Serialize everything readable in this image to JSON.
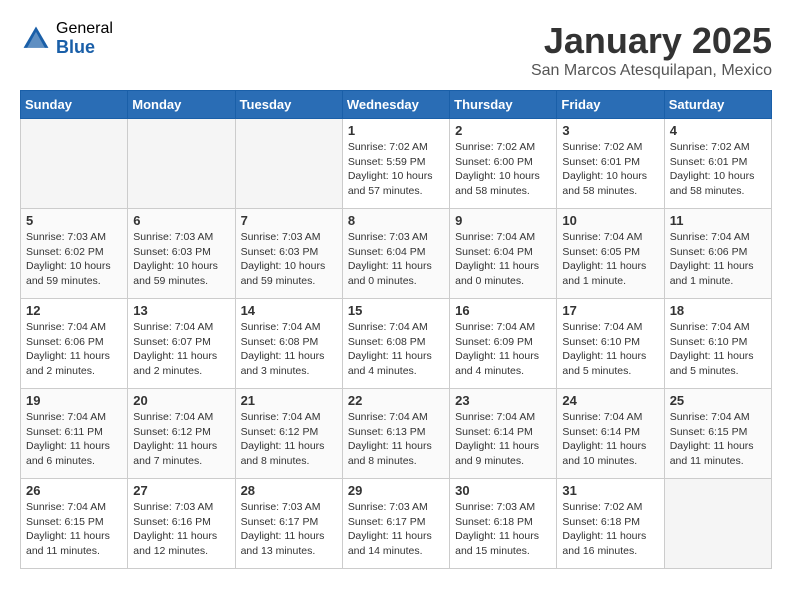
{
  "header": {
    "logo_general": "General",
    "logo_blue": "Blue",
    "month_title": "January 2025",
    "location": "San Marcos Atesquilapan, Mexico"
  },
  "days_of_week": [
    "Sunday",
    "Monday",
    "Tuesday",
    "Wednesday",
    "Thursday",
    "Friday",
    "Saturday"
  ],
  "weeks": [
    [
      {
        "num": "",
        "empty": true
      },
      {
        "num": "",
        "empty": true
      },
      {
        "num": "",
        "empty": true
      },
      {
        "num": "1",
        "sunrise": "Sunrise: 7:02 AM",
        "sunset": "Sunset: 5:59 PM",
        "daylight": "Daylight: 10 hours and 57 minutes."
      },
      {
        "num": "2",
        "sunrise": "Sunrise: 7:02 AM",
        "sunset": "Sunset: 6:00 PM",
        "daylight": "Daylight: 10 hours and 58 minutes."
      },
      {
        "num": "3",
        "sunrise": "Sunrise: 7:02 AM",
        "sunset": "Sunset: 6:01 PM",
        "daylight": "Daylight: 10 hours and 58 minutes."
      },
      {
        "num": "4",
        "sunrise": "Sunrise: 7:02 AM",
        "sunset": "Sunset: 6:01 PM",
        "daylight": "Daylight: 10 hours and 58 minutes."
      }
    ],
    [
      {
        "num": "5",
        "sunrise": "Sunrise: 7:03 AM",
        "sunset": "Sunset: 6:02 PM",
        "daylight": "Daylight: 10 hours and 59 minutes."
      },
      {
        "num": "6",
        "sunrise": "Sunrise: 7:03 AM",
        "sunset": "Sunset: 6:03 PM",
        "daylight": "Daylight: 10 hours and 59 minutes."
      },
      {
        "num": "7",
        "sunrise": "Sunrise: 7:03 AM",
        "sunset": "Sunset: 6:03 PM",
        "daylight": "Daylight: 10 hours and 59 minutes."
      },
      {
        "num": "8",
        "sunrise": "Sunrise: 7:03 AM",
        "sunset": "Sunset: 6:04 PM",
        "daylight": "Daylight: 11 hours and 0 minutes."
      },
      {
        "num": "9",
        "sunrise": "Sunrise: 7:04 AM",
        "sunset": "Sunset: 6:04 PM",
        "daylight": "Daylight: 11 hours and 0 minutes."
      },
      {
        "num": "10",
        "sunrise": "Sunrise: 7:04 AM",
        "sunset": "Sunset: 6:05 PM",
        "daylight": "Daylight: 11 hours and 1 minute."
      },
      {
        "num": "11",
        "sunrise": "Sunrise: 7:04 AM",
        "sunset": "Sunset: 6:06 PM",
        "daylight": "Daylight: 11 hours and 1 minute."
      }
    ],
    [
      {
        "num": "12",
        "sunrise": "Sunrise: 7:04 AM",
        "sunset": "Sunset: 6:06 PM",
        "daylight": "Daylight: 11 hours and 2 minutes."
      },
      {
        "num": "13",
        "sunrise": "Sunrise: 7:04 AM",
        "sunset": "Sunset: 6:07 PM",
        "daylight": "Daylight: 11 hours and 2 minutes."
      },
      {
        "num": "14",
        "sunrise": "Sunrise: 7:04 AM",
        "sunset": "Sunset: 6:08 PM",
        "daylight": "Daylight: 11 hours and 3 minutes."
      },
      {
        "num": "15",
        "sunrise": "Sunrise: 7:04 AM",
        "sunset": "Sunset: 6:08 PM",
        "daylight": "Daylight: 11 hours and 4 minutes."
      },
      {
        "num": "16",
        "sunrise": "Sunrise: 7:04 AM",
        "sunset": "Sunset: 6:09 PM",
        "daylight": "Daylight: 11 hours and 4 minutes."
      },
      {
        "num": "17",
        "sunrise": "Sunrise: 7:04 AM",
        "sunset": "Sunset: 6:10 PM",
        "daylight": "Daylight: 11 hours and 5 minutes."
      },
      {
        "num": "18",
        "sunrise": "Sunrise: 7:04 AM",
        "sunset": "Sunset: 6:10 PM",
        "daylight": "Daylight: 11 hours and 5 minutes."
      }
    ],
    [
      {
        "num": "19",
        "sunrise": "Sunrise: 7:04 AM",
        "sunset": "Sunset: 6:11 PM",
        "daylight": "Daylight: 11 hours and 6 minutes."
      },
      {
        "num": "20",
        "sunrise": "Sunrise: 7:04 AM",
        "sunset": "Sunset: 6:12 PM",
        "daylight": "Daylight: 11 hours and 7 minutes."
      },
      {
        "num": "21",
        "sunrise": "Sunrise: 7:04 AM",
        "sunset": "Sunset: 6:12 PM",
        "daylight": "Daylight: 11 hours and 8 minutes."
      },
      {
        "num": "22",
        "sunrise": "Sunrise: 7:04 AM",
        "sunset": "Sunset: 6:13 PM",
        "daylight": "Daylight: 11 hours and 8 minutes."
      },
      {
        "num": "23",
        "sunrise": "Sunrise: 7:04 AM",
        "sunset": "Sunset: 6:14 PM",
        "daylight": "Daylight: 11 hours and 9 minutes."
      },
      {
        "num": "24",
        "sunrise": "Sunrise: 7:04 AM",
        "sunset": "Sunset: 6:14 PM",
        "daylight": "Daylight: 11 hours and 10 minutes."
      },
      {
        "num": "25",
        "sunrise": "Sunrise: 7:04 AM",
        "sunset": "Sunset: 6:15 PM",
        "daylight": "Daylight: 11 hours and 11 minutes."
      }
    ],
    [
      {
        "num": "26",
        "sunrise": "Sunrise: 7:04 AM",
        "sunset": "Sunset: 6:15 PM",
        "daylight": "Daylight: 11 hours and 11 minutes."
      },
      {
        "num": "27",
        "sunrise": "Sunrise: 7:03 AM",
        "sunset": "Sunset: 6:16 PM",
        "daylight": "Daylight: 11 hours and 12 minutes."
      },
      {
        "num": "28",
        "sunrise": "Sunrise: 7:03 AM",
        "sunset": "Sunset: 6:17 PM",
        "daylight": "Daylight: 11 hours and 13 minutes."
      },
      {
        "num": "29",
        "sunrise": "Sunrise: 7:03 AM",
        "sunset": "Sunset: 6:17 PM",
        "daylight": "Daylight: 11 hours and 14 minutes."
      },
      {
        "num": "30",
        "sunrise": "Sunrise: 7:03 AM",
        "sunset": "Sunset: 6:18 PM",
        "daylight": "Daylight: 11 hours and 15 minutes."
      },
      {
        "num": "31",
        "sunrise": "Sunrise: 7:02 AM",
        "sunset": "Sunset: 6:18 PM",
        "daylight": "Daylight: 11 hours and 16 minutes."
      },
      {
        "num": "",
        "empty": true
      }
    ]
  ]
}
